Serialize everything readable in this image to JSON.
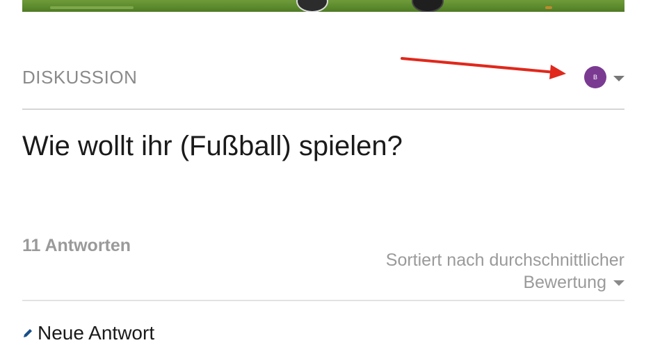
{
  "section": {
    "label": "DISKUSSION"
  },
  "user": {
    "avatar_initial": "B",
    "avatar_color": "#7b3a92"
  },
  "discussion": {
    "title": "Wie wollt ihr (Fußball) spielen?"
  },
  "answers": {
    "count_label": "11 Antworten",
    "sort_label": "Sortiert nach durchschnittlicher Bewertung",
    "new_answer_label": "Neue Antwort"
  },
  "colors": {
    "annotation_arrow": "#e0281c",
    "muted_text": "#9a9a9a"
  },
  "icons": {
    "user_menu_caret": "chevron-down-icon",
    "annotation": "red-arrow-icon",
    "new_answer": "pencil-icon"
  }
}
